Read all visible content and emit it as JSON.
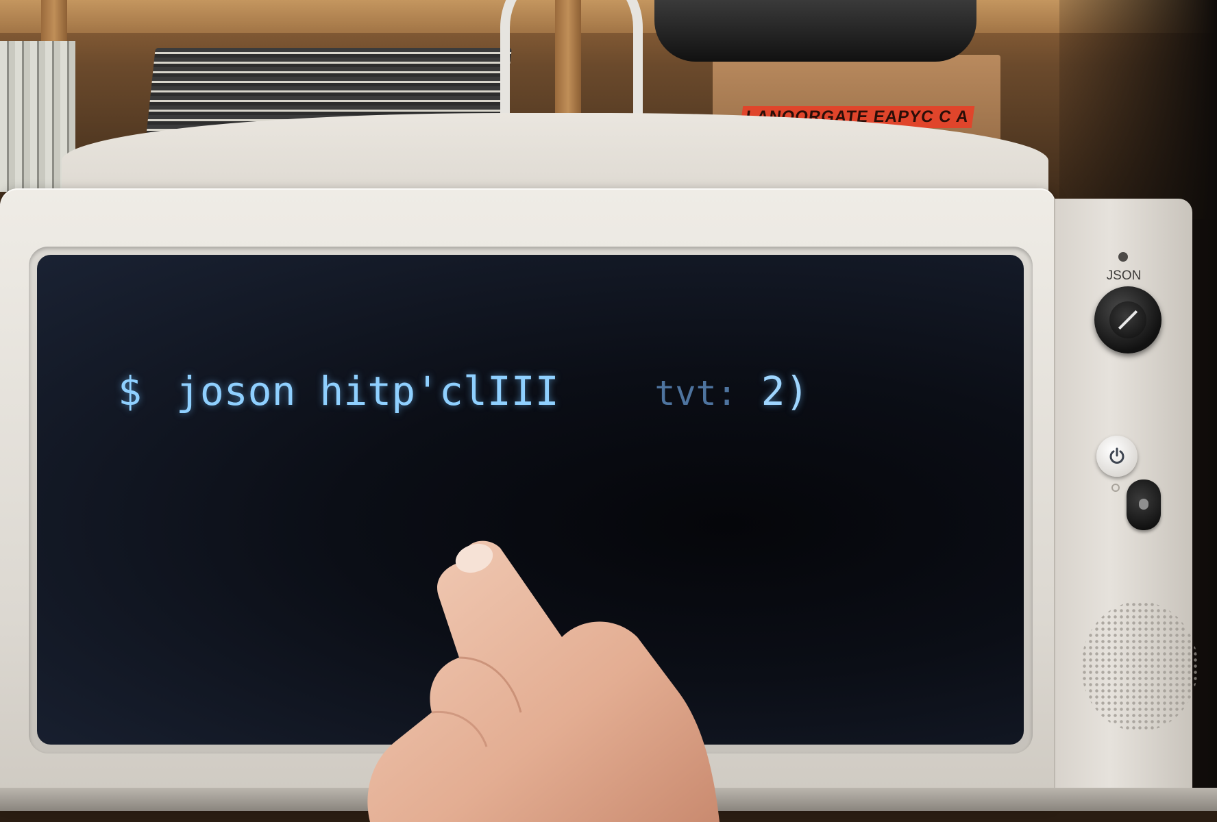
{
  "scene": {
    "box_label": "LANOORGATE EAPYC C A"
  },
  "device": {
    "side_label": "JSON",
    "controls": [
      {
        "name": "knob",
        "icon": "rotary-knob-icon"
      },
      {
        "name": "power",
        "icon": "power-icon"
      },
      {
        "name": "toggle",
        "icon": "toggle-switch-icon"
      }
    ]
  },
  "terminal": {
    "prompt": "$",
    "command": "joson hitp'clIII",
    "suffix_dim": "tvt:",
    "suffix": "2)",
    "text_color": "#8fd0ff"
  },
  "colors": {
    "screen": "#0b0e16",
    "bezel": "#dcd9d3",
    "label_red": "#e0452b"
  }
}
